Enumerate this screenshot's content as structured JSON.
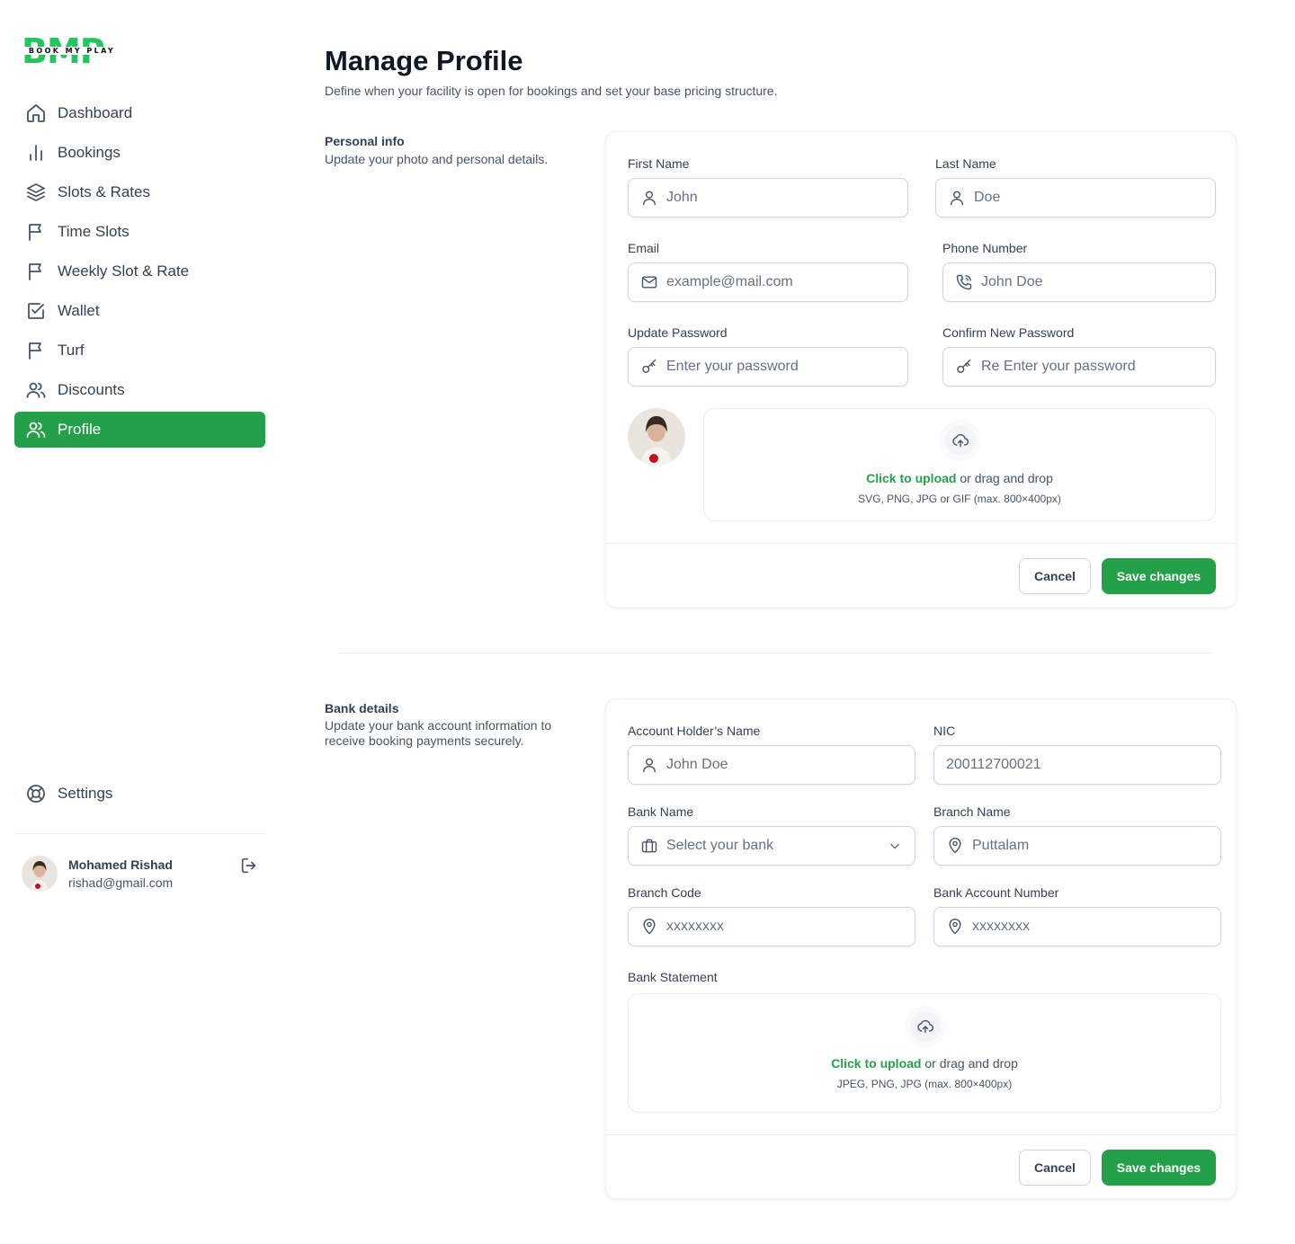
{
  "brand": {
    "logo_letters": "BMP",
    "logo_tagline": "BOOK MY PLAY",
    "accent": "#24a148"
  },
  "sidebar": {
    "items": [
      {
        "label": "Dashboard",
        "icon": "home-icon"
      },
      {
        "label": "Bookings",
        "icon": "bar-chart-icon"
      },
      {
        "label": "Slots & Rates",
        "icon": "layers-icon"
      },
      {
        "label": "Time Slots",
        "icon": "flag-icon"
      },
      {
        "label": "Weekly Slot & Rate",
        "icon": "flag-icon"
      },
      {
        "label": "Wallet",
        "icon": "check-square-icon"
      },
      {
        "label": "Turf",
        "icon": "flag-icon"
      },
      {
        "label": "Discounts",
        "icon": "users-icon"
      },
      {
        "label": "Profile",
        "icon": "users-icon",
        "active": true
      }
    ],
    "settings_label": "Settings",
    "user": {
      "name": "Mohamed Rishad",
      "email": "rishad@gmail.com"
    }
  },
  "header": {
    "title": "Manage Profile",
    "subtitle": "Define when your facility is open for bookings and set your base pricing structure."
  },
  "personal": {
    "label": "Personal info",
    "description": "Update your photo and personal details.",
    "first_name_label": "First Name",
    "first_name_value": "John",
    "last_name_label": "Last Name",
    "last_name_value": "Doe",
    "email_label": "Email",
    "email_placeholder": "example@mail.com",
    "phone_label": "Phone Number",
    "phone_value": "John Doe",
    "password_label": "Update Password",
    "password_placeholder": "Enter your password",
    "confirm_label": "Confirm New Password",
    "confirm_placeholder": "Re Enter your password",
    "upload_link": "Click to upload",
    "upload_rest": " or drag and drop",
    "upload_hint": "SVG, PNG, JPG or GIF (max. 800×400px)",
    "cancel": "Cancel",
    "save": "Save changes"
  },
  "bank": {
    "label": "Bank details",
    "description": "Update your bank account information to receive booking payments securely.",
    "holder_label": "Account Holder’s Name",
    "holder_value": "John Doe",
    "nic_label": "NIC",
    "nic_value": "200112700021",
    "bank_name_label": "Bank Name",
    "bank_name_placeholder": "Select your bank",
    "branch_name_label": "Branch Name",
    "branch_name_value": "Puttalam",
    "branch_code_label": "Branch Code",
    "branch_code_value": "xxxxxxxx",
    "account_number_label": "Bank Account Number",
    "account_number_value": "xxxxxxxx",
    "statement_label": "Bank Statement",
    "upload_link": "Click to upload",
    "upload_rest": " or drag and drop",
    "upload_hint": "JPEG, PNG, JPG (max. 800×400px)",
    "cancel": "Cancel",
    "save": "Save changes"
  }
}
